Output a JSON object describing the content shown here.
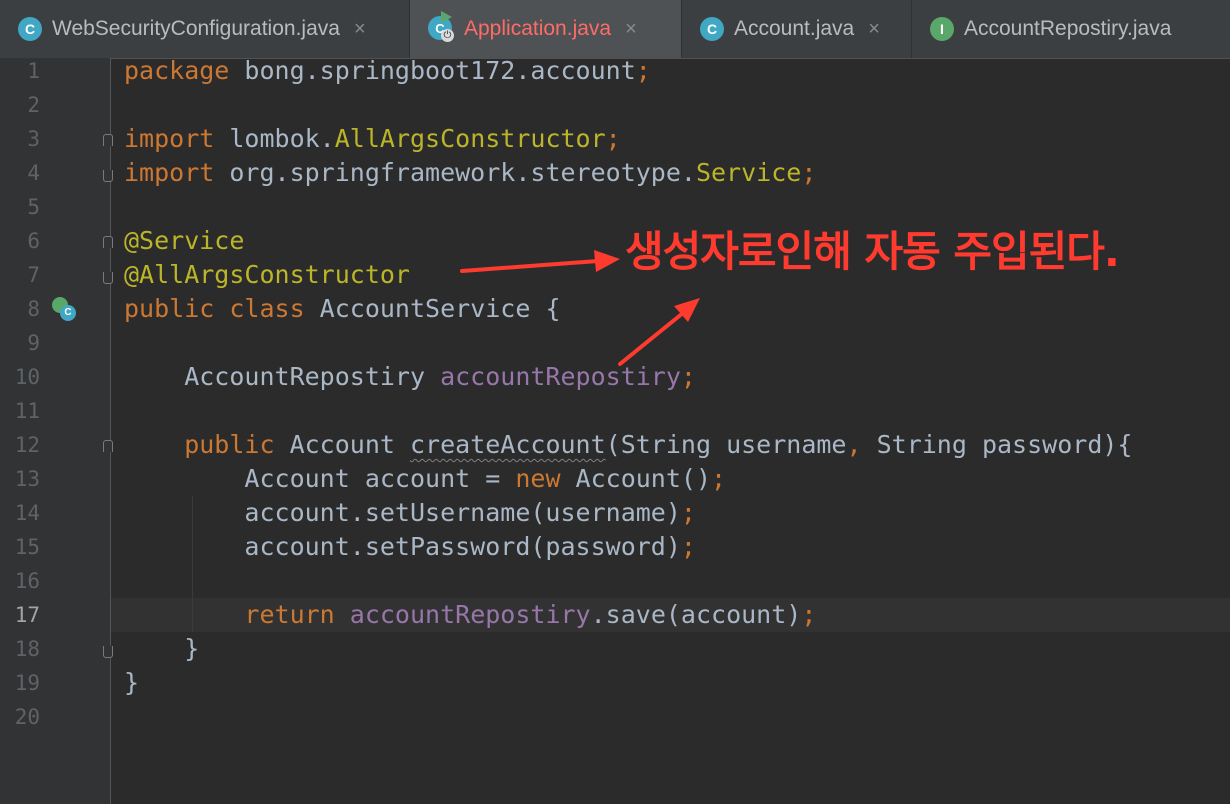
{
  "tabs": [
    {
      "label": "WebSecurityConfiguration.java",
      "icon": "class-c-icon",
      "badge": "C",
      "badge_color": "#40a8c4",
      "active": false
    },
    {
      "label": "Application.java",
      "icon": "application-run-icon",
      "badge": "C",
      "badge_color": "#40a8c4",
      "active": true
    },
    {
      "label": "Account.java",
      "icon": "class-c-icon",
      "badge": "C",
      "badge_color": "#40a8c4",
      "active": false
    },
    {
      "label": "AccountRepostiry.java",
      "icon": "interface-i-icon",
      "badge": "I",
      "badge_color": "#59a869",
      "active": false
    }
  ],
  "tab_close_glyph": "×",
  "line_numbers": [
    "1",
    "2",
    "3",
    "4",
    "5",
    "6",
    "7",
    "8",
    "9",
    "10",
    "11",
    "12",
    "13",
    "14",
    "15",
    "16",
    "17",
    "18",
    "19",
    "20"
  ],
  "current_line": "17",
  "code": {
    "l1": {
      "kw": "package",
      "text": " bong.springboot172.account",
      "semi": ";"
    },
    "l3": {
      "kw": "import",
      "text": " lombok.",
      "cls": "AllArgsConstructor",
      "semi": ";"
    },
    "l4": {
      "kw": "import",
      "text": " org.springframework.stereotype.",
      "cls": "Service",
      "semi": ";"
    },
    "l6": {
      "ann": "@Service"
    },
    "l7": {
      "ann": "@AllArgsConstructor"
    },
    "l8": {
      "kw": "public class",
      "text": " AccountService {"
    },
    "l10": {
      "type": "    AccountRepostiry ",
      "field": "accountRepostiry",
      "semi": ";"
    },
    "l12": {
      "kw": "    public",
      "type": " Account ",
      "method": "createAccount",
      "params": "(String username",
      "comma": ",",
      "rest": " String password){"
    },
    "l13": {
      "a": "        Account account = ",
      "kw": "new",
      "b": " Account()",
      "semi": ";"
    },
    "l14": {
      "a": "        account.setUsername(username)",
      "semi": ";"
    },
    "l15": {
      "a": "        account.setPassword(password)",
      "semi": ";"
    },
    "l17": {
      "kw": "        return",
      "sp": " ",
      "field": "accountRepostiry",
      "b": ".save(account)",
      "semi": ";"
    },
    "l18": {
      "a": "    }"
    },
    "l19": {
      "a": "}"
    }
  },
  "annotation_note": "생성자로인해  자동 주입된다.",
  "colors": {
    "background": "#2b2b2b",
    "keyword": "#cc7832",
    "annotation": "#bbb529",
    "field": "#9876aa",
    "text": "#a9b7c6",
    "note_red": "#ff3b30"
  }
}
